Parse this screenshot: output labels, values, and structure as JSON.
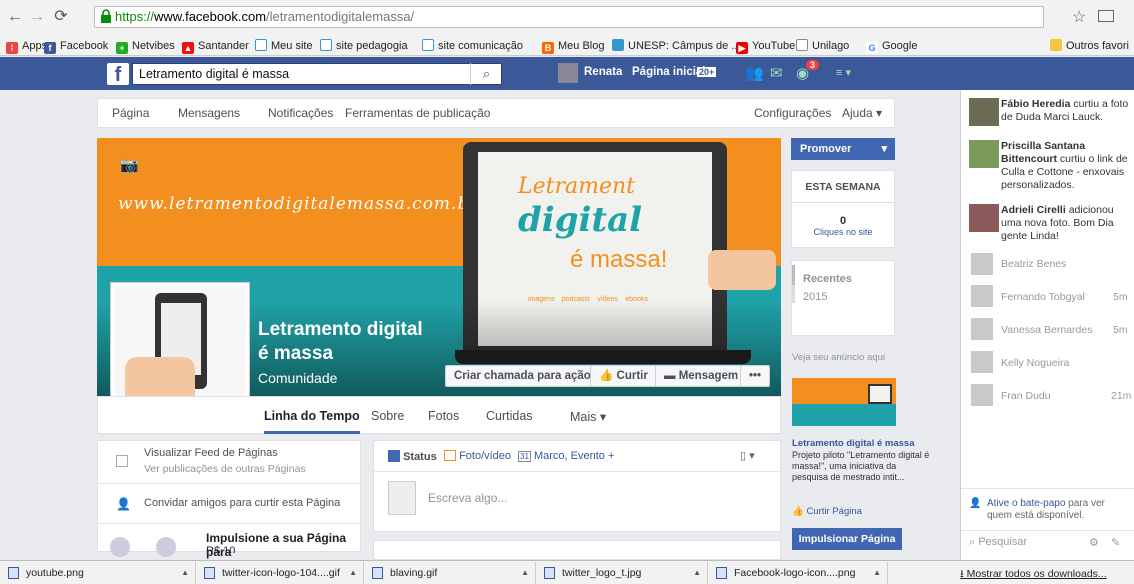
{
  "browser": {
    "url_scheme": "https://",
    "url_domain": "www.facebook.com",
    "url_path": "/letramentodigitalemassa/",
    "bookmarks": [
      "Apps",
      "Facebook",
      "Netvibes",
      "Santander",
      "Meu site",
      "site pedagogia",
      "site comunicação",
      "Meu Blog",
      "UNESP: Câmpus de ...",
      "YouTube",
      "Unilago",
      "Google"
    ],
    "other_bookmarks": "Outros favori"
  },
  "fb": {
    "search_value": "Letramento digital é massa",
    "user": "Renata",
    "home": "Página inicial",
    "home_count": "20+",
    "notif_count": "3"
  },
  "pagenav": {
    "items": [
      "Página",
      "Mensagens",
      "Notificações",
      "Ferramentas de publicação"
    ],
    "settings": "Configurações",
    "help": "Ajuda ▾"
  },
  "cover": {
    "url_text": "www.letramentodigitalemassa.com.br",
    "screen_line1": "Letrament",
    "screen_line2": "digital",
    "screen_line3": "é massa!",
    "media_labels": [
      "imagens",
      "podcasts",
      "vídeos",
      "ebooks"
    ]
  },
  "page": {
    "name_line1": "Letramento digital",
    "name_line2": "é massa",
    "category": "Comunidade",
    "buttons": [
      "Criar chamada para ação",
      "Curtir",
      "Mensagem",
      "•••"
    ],
    "tabs": [
      "Linha do Tempo",
      "Sobre",
      "Fotos",
      "Curtidas",
      "Mais ▾"
    ]
  },
  "right": {
    "promote": "Promover",
    "week_title": "ESTA SEMANA",
    "clicks": "0",
    "clicks_label": "Cliques no site",
    "recent_title": "Recentes",
    "recent_year": "2015",
    "ad_title": "Veja seu anúncio aqui",
    "ad_page": "Letramento digital é massa",
    "ad_text": "Projeto piloto \"Letramento digital é massa!\", uma iniciativa da pesquisa de mestrado intit...",
    "ad_like": "Curtir Página",
    "boost": "Impulsionar Página"
  },
  "left": {
    "feed_title": "Visualizar Feed de Páginas",
    "feed_sub": "Ver publicações de outras Páginas",
    "invite": "Convidar amigos para curtir esta Página",
    "boost_title": "Impulsione a sua Página para",
    "boost_price": "R$ 10"
  },
  "composer": {
    "status": "Status",
    "photo": "Foto/vídeo",
    "event": "Marco, Evento +",
    "placeholder": "Escreva algo..."
  },
  "ticker": [
    {
      "bold": "Fábio Heredia",
      "text": " curtiu a foto de Duda Marci Lauck."
    },
    {
      "bold": "Priscilla Santana Bittencourt",
      "text": " curtiu o link de Culla e Cottone - enxovais personalizados."
    },
    {
      "bold": "Adrieli Cirelli",
      "text": " adicionou uma nova foto. Bom Dia gente Linda!"
    }
  ],
  "chat": [
    {
      "name": "Beatriz Benes",
      "t": ""
    },
    {
      "name": "Fernando Tobgyal",
      "t": "5m"
    },
    {
      "name": "Vanessa Bernardes",
      "t": "5m"
    },
    {
      "name": "Kelly Nogueira",
      "t": ""
    },
    {
      "name": "Fran Dudu",
      "t": "21m"
    }
  ],
  "chat_footer": {
    "link": "Ative o bate-papo",
    "rest": " para ver quem está disponível.",
    "search": "Pesquisar"
  },
  "downloads": {
    "files": [
      "youtube.png",
      "twitter-icon-logo-104....gif",
      "blaving.gif",
      "twitter_logo_t.jpg",
      "Facebook-logo-icon....png"
    ],
    "show_all": "Mostrar todos os downloads..."
  }
}
